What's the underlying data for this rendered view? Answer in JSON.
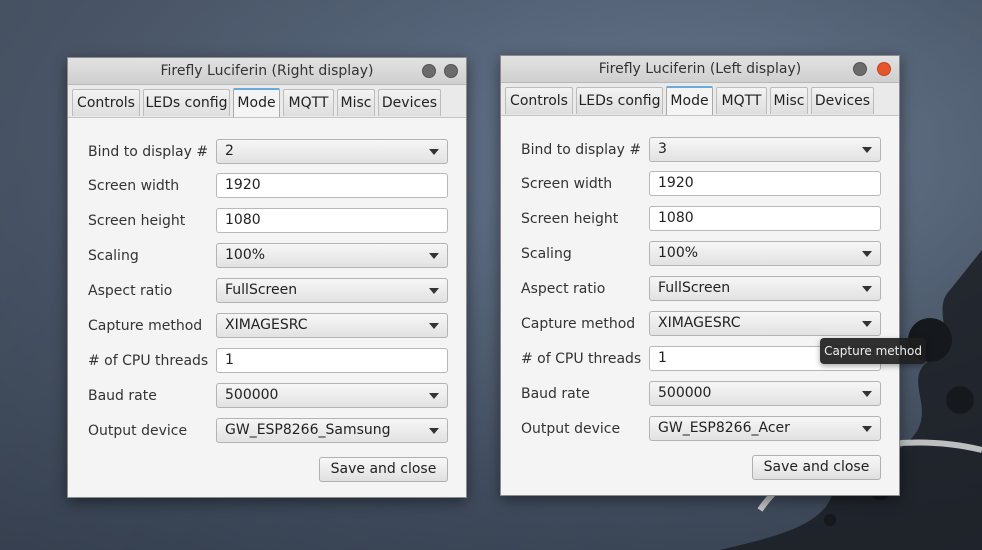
{
  "windows": [
    {
      "title": "Firefly Luciferin (Right display)",
      "tabs": [
        "Controls",
        "LEDs config",
        "Mode",
        "MQTT",
        "Misc",
        "Devices"
      ],
      "active_tab": "Mode",
      "fields": {
        "bind_display": {
          "label": "Bind to display #",
          "value": "2"
        },
        "screen_width": {
          "label": "Screen width",
          "value": "1920"
        },
        "screen_height": {
          "label": "Screen height",
          "value": "1080"
        },
        "scaling": {
          "label": "Scaling",
          "value": "100%"
        },
        "aspect_ratio": {
          "label": "Aspect ratio",
          "value": "FullScreen"
        },
        "capture_method": {
          "label": "Capture method",
          "value": "XIMAGESRC"
        },
        "cpu_threads": {
          "label": "# of CPU threads",
          "value": "1"
        },
        "baud_rate": {
          "label": "Baud rate",
          "value": "500000"
        },
        "output_device": {
          "label": "Output device",
          "value": "GW_ESP8266_Samsung"
        }
      },
      "save_label": "Save and close"
    },
    {
      "title": "Firefly Luciferin (Left display)",
      "tabs": [
        "Controls",
        "LEDs config",
        "Mode",
        "MQTT",
        "Misc",
        "Devices"
      ],
      "active_tab": "Mode",
      "fields": {
        "bind_display": {
          "label": "Bind to display #",
          "value": "3"
        },
        "screen_width": {
          "label": "Screen width",
          "value": "1920"
        },
        "screen_height": {
          "label": "Screen height",
          "value": "1080"
        },
        "scaling": {
          "label": "Scaling",
          "value": "100%"
        },
        "aspect_ratio": {
          "label": "Aspect ratio",
          "value": "FullScreen"
        },
        "capture_method": {
          "label": "Capture method",
          "value": "XIMAGESRC"
        },
        "cpu_threads": {
          "label": "# of CPU threads",
          "value": "1"
        },
        "baud_rate": {
          "label": "Baud rate",
          "value": "500000"
        },
        "output_device": {
          "label": "Output device",
          "value": "GW_ESP8266_Acer"
        }
      },
      "save_label": "Save and close"
    }
  ],
  "tooltip": {
    "text": "Capture method"
  },
  "colors": {
    "accent": "#6aa9d8",
    "close_button": "#e4572e",
    "window_bg": "#f4f4f4"
  }
}
